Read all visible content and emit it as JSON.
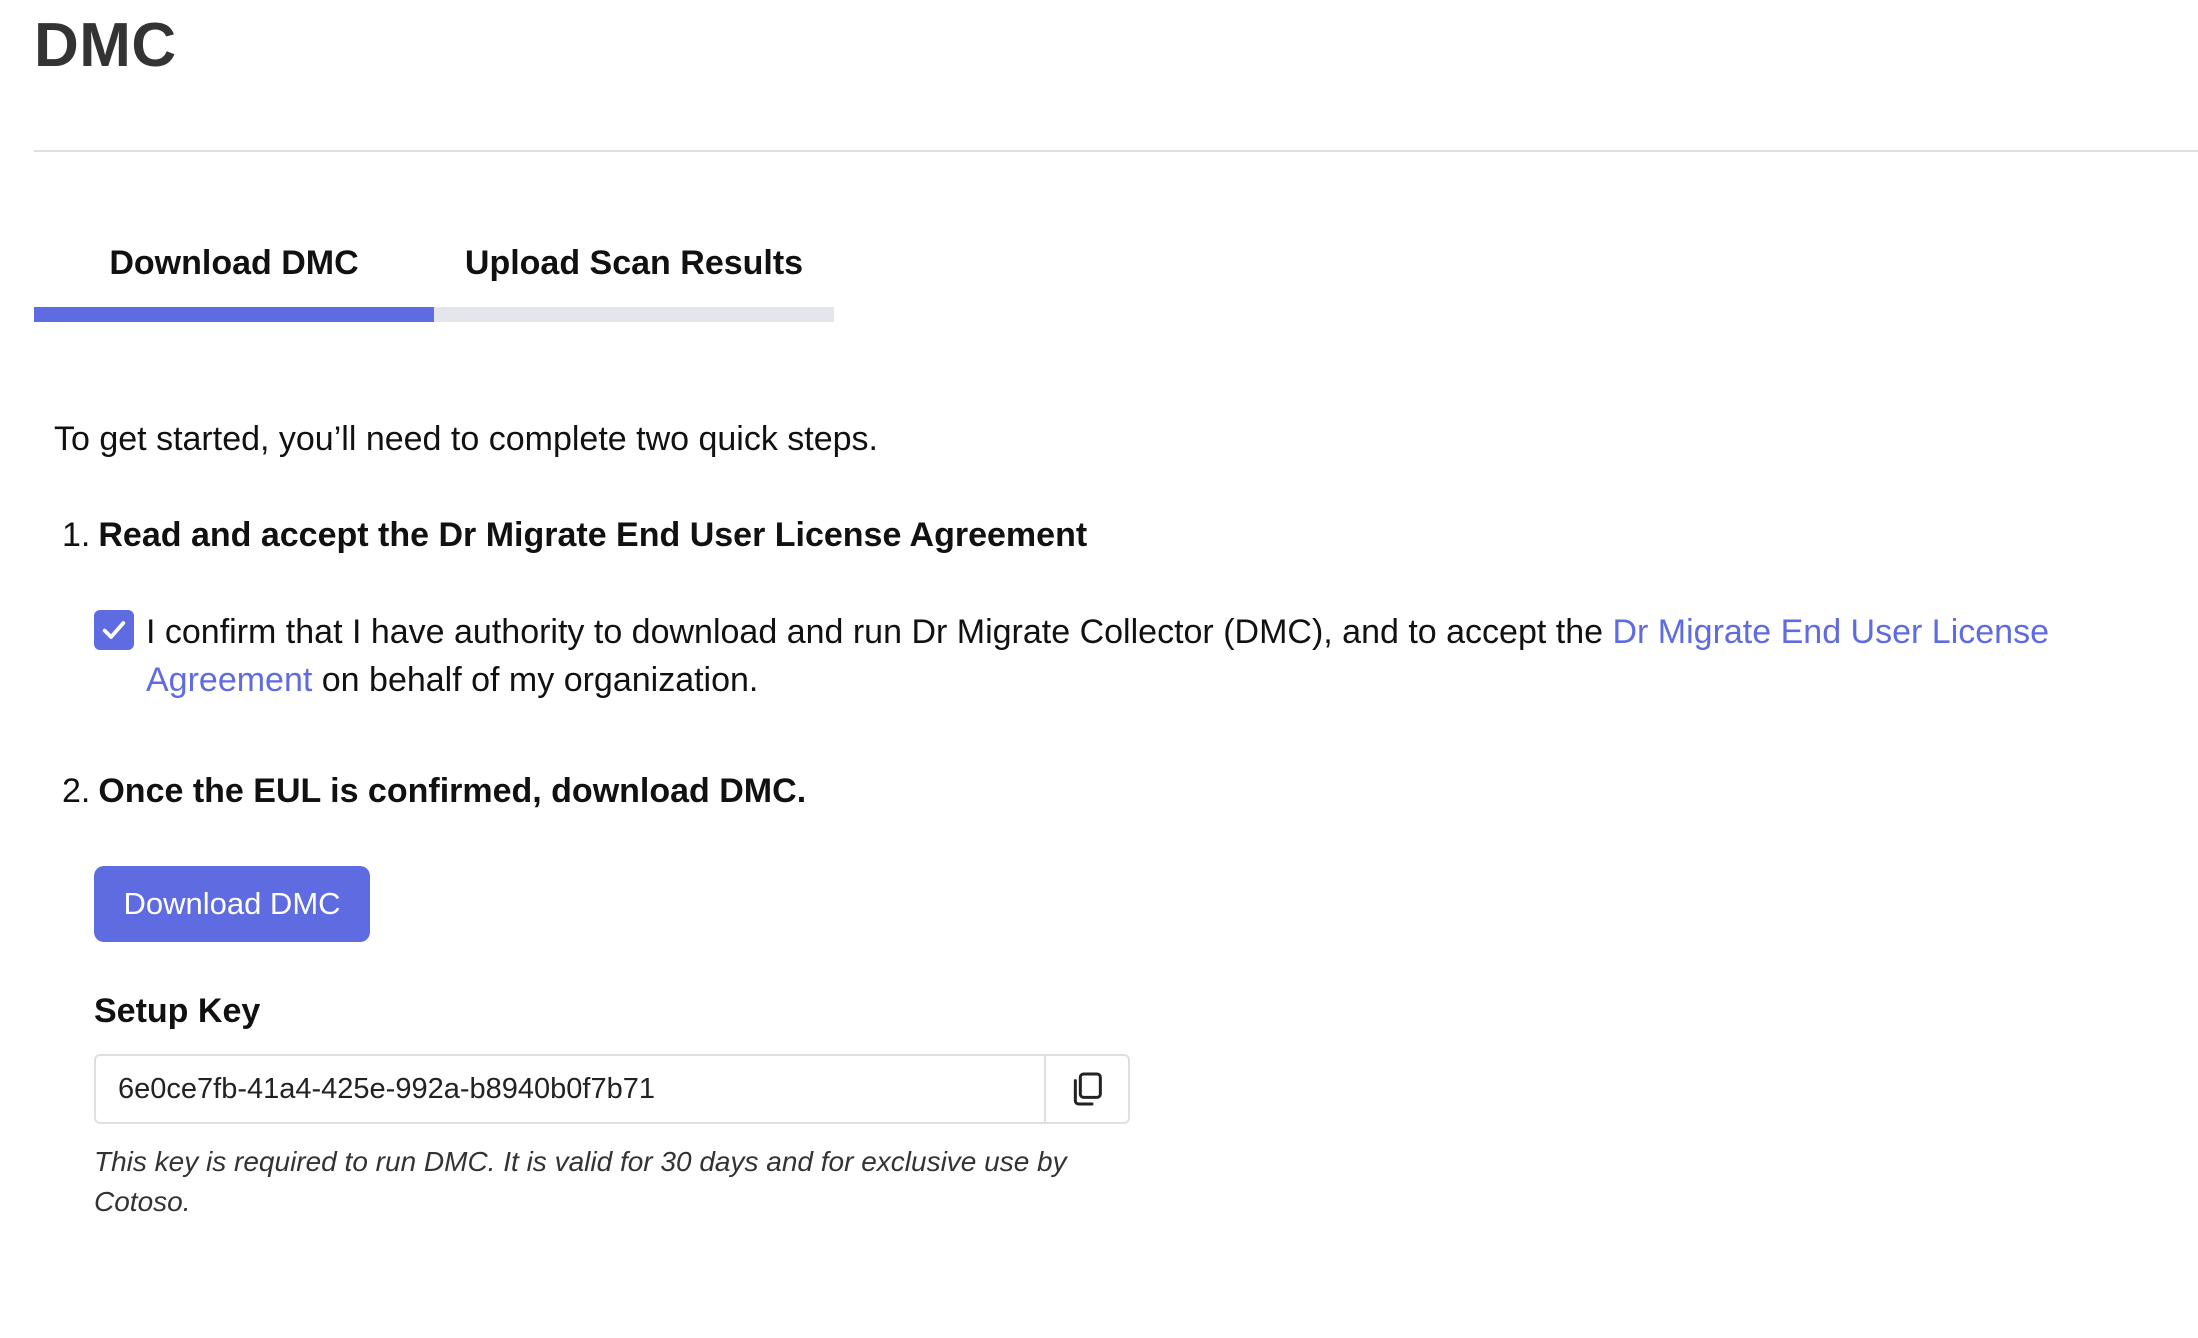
{
  "page": {
    "title": "DMC"
  },
  "tabs": [
    {
      "label": "Download DMC",
      "active": true
    },
    {
      "label": "Upload Scan Results",
      "active": false
    }
  ],
  "content": {
    "intro": "To get started, you’ll need to complete two quick steps.",
    "step1": {
      "number": "1.",
      "heading": "Read and accept the Dr Migrate End User License Agreement",
      "checkbox_checked": true,
      "confirm_text_before": "I confirm that I have authority to download and run Dr Migrate Collector (DMC), and to accept the ",
      "confirm_link": "Dr Migrate End User License Agreement",
      "confirm_text_after": " on behalf of my organization."
    },
    "step2": {
      "number": "2.",
      "heading": "Once the EUL is confirmed, download DMC.",
      "button_label": "Download DMC"
    },
    "setup_key": {
      "label": "Setup Key",
      "value": "6e0ce7fb-41a4-425e-992a-b8940b0f7b71",
      "copy_icon": "copy-icon",
      "note": "This key is required to run DMC. It is valid for 30 days and for exclusive use by Cotoso."
    }
  },
  "colors": {
    "accent": "#5f6be0",
    "tab_inactive_bar": "#e4e6eb",
    "divider": "#e0e0e3"
  }
}
